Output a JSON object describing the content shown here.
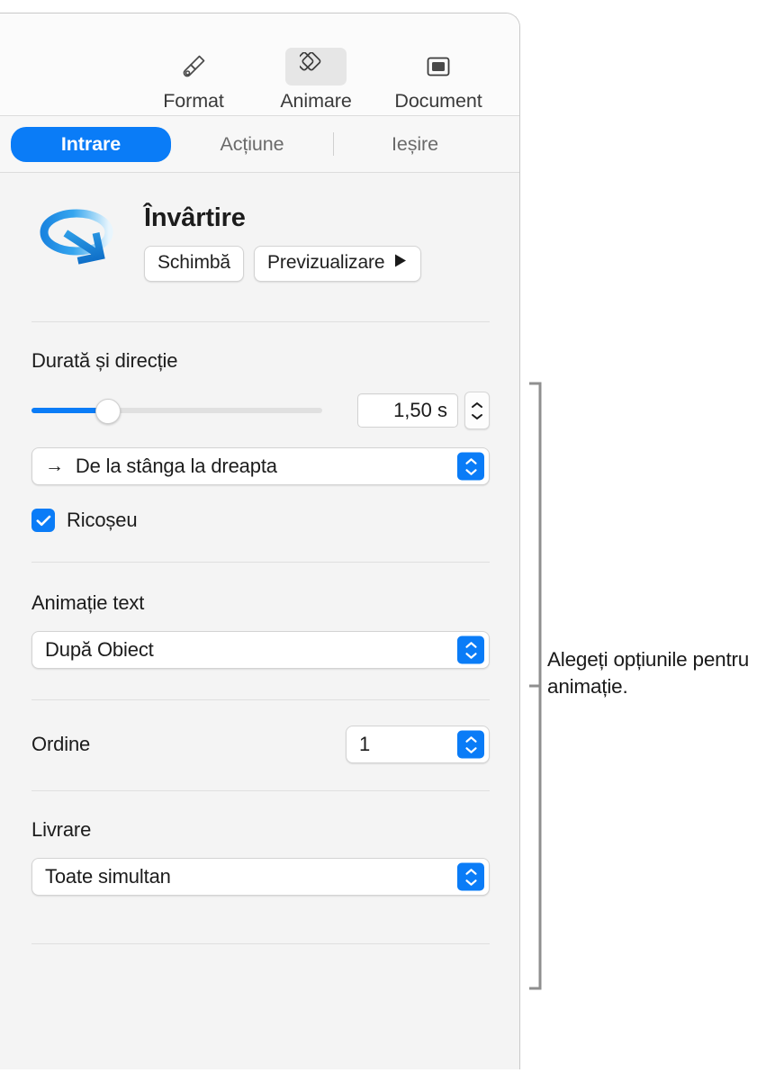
{
  "panel": {
    "toolbar": {
      "items": [
        {
          "label": "Format",
          "icon": "paintbrush-icon",
          "selected": false
        },
        {
          "label": "Animare",
          "icon": "animate-diamonds-icon",
          "selected": true
        },
        {
          "label": "Document",
          "icon": "document-icon",
          "selected": false
        }
      ]
    },
    "tabs": [
      {
        "label": "Intrare",
        "selected": true
      },
      {
        "label": "Acțiune",
        "selected": false
      },
      {
        "label": "Ieșire",
        "selected": false
      }
    ],
    "hero": {
      "icon": "rotate-swirl-arrow-icon",
      "title": "Învârtire",
      "change_button": "Schimbă",
      "preview_button": "Previzualizare",
      "preview_icon": "play-triangle-icon"
    },
    "duration": {
      "label": "Durată și direcție",
      "slider_value_percent": 27,
      "value": "1,50 s",
      "direction": {
        "arrow": "→",
        "value": "De la stânga la dreapta"
      }
    },
    "bounce": {
      "label": "Ricoșeu",
      "checked": true
    },
    "text_animation": {
      "label": "Animație text",
      "value": "După Obiect"
    },
    "order": {
      "label": "Ordine",
      "value": "1"
    },
    "delivery": {
      "label": "Livrare",
      "value": "Toate simultan"
    }
  },
  "callout": {
    "text": "Alegeți opțiunile pentru animație."
  },
  "colors": {
    "accent": "#0a7cf7",
    "panel_bg": "#f4f4f4",
    "toolbar_bg": "#fbfbfb",
    "text": "#1c1c1c",
    "muted_text": "#6a6a6a"
  }
}
